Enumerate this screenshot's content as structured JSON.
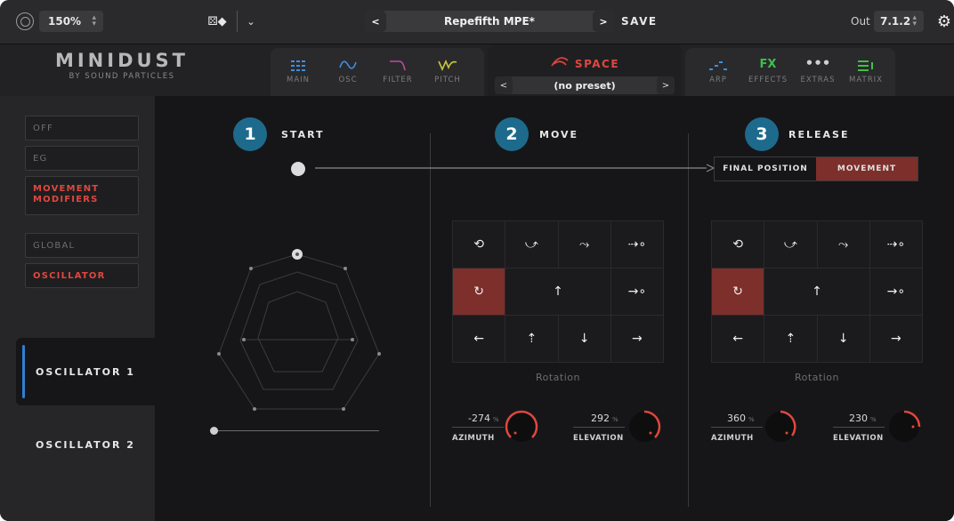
{
  "topbar": {
    "zoom": "150%",
    "preset_prev": "<",
    "preset_name": "Repefifth MPE*",
    "preset_next": ">",
    "save_label": "SAVE",
    "out_label": "Out",
    "out_value": "7.1.2"
  },
  "brand": {
    "name": "MINIDUST",
    "subtitle": "BY SOUND PARTICLES"
  },
  "tabs_left": [
    {
      "label": "MAIN",
      "icon": "grid-icon",
      "color": "#3d8fe0"
    },
    {
      "label": "OSC",
      "icon": "wave-icon",
      "color": "#3d8fe0"
    },
    {
      "label": "FILTER",
      "icon": "filter-icon",
      "color": "#c04ca0"
    },
    {
      "label": "PITCH",
      "icon": "pitch-icon",
      "color": "#c8c83a"
    }
  ],
  "space": {
    "label": "SPACE",
    "preset": "(no preset)",
    "color": "#e0473e"
  },
  "tabs_right": [
    {
      "label": "ARP",
      "icon": "arp-icon",
      "color": "#3d8fe0"
    },
    {
      "label": "EFFECTS",
      "icon": "FX",
      "color": "#3fbf4a"
    },
    {
      "label": "EXTRAS",
      "icon": "dots-icon",
      "color": "#cfcfcf"
    },
    {
      "label": "MATRIX",
      "icon": "matrix-icon",
      "color": "#3fbf4a"
    }
  ],
  "sidebar": {
    "mode_items": [
      "OFF",
      "EG",
      "MOVEMENT MODIFIERS"
    ],
    "scope_items": [
      "GLOBAL",
      "OSCILLATOR"
    ],
    "oscillators": [
      "OSCILLATOR 1",
      "OSCILLATOR 2"
    ]
  },
  "steps": {
    "start": {
      "num": "1",
      "label": "START"
    },
    "move": {
      "num": "2",
      "label": "MOVE"
    },
    "release": {
      "num": "3",
      "label": "RELEASE"
    }
  },
  "release_toggle": {
    "left": "FINAL POSITION",
    "right": "MOVEMENT"
  },
  "rotation_label": "Rotation",
  "move_knobs": {
    "azimuth": {
      "value": "-274",
      "unit": "%",
      "name": "AZIMUTH"
    },
    "elevation": {
      "value": "292",
      "unit": "%",
      "name": "ELEVATION"
    }
  },
  "release_knobs": {
    "azimuth": {
      "value": "360",
      "unit": "%",
      "name": "AZIMUTH"
    },
    "elevation": {
      "value": "230",
      "unit": "%",
      "name": "ELEVATION"
    }
  },
  "colors": {
    "accent": "#e0473e",
    "active_cell": "#7d2f2b",
    "step_badge": "#1e6a8c",
    "osc_indicator": "#2f7fd3"
  }
}
